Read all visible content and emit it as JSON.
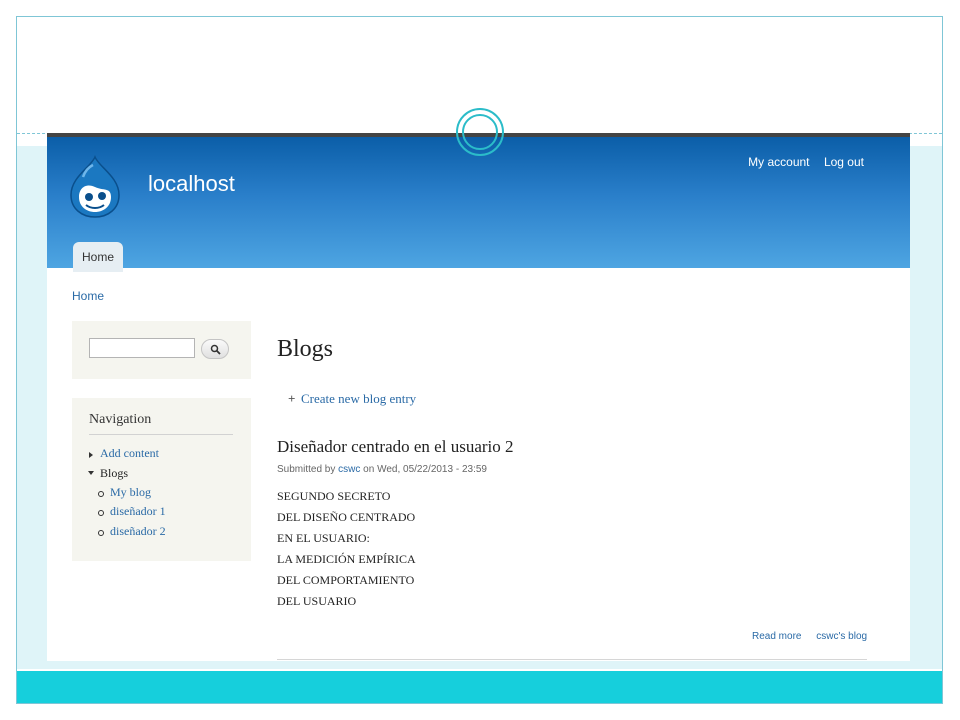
{
  "site": {
    "name": "localhost"
  },
  "secondary_menu": {
    "items": [
      "My account",
      "Log out"
    ]
  },
  "main_menu": {
    "tabs": [
      "Home"
    ]
  },
  "breadcrumb": "Home",
  "search": {
    "value": "",
    "button_icon": "search-icon"
  },
  "navigation": {
    "title": "Navigation",
    "items": [
      "Add content",
      "Blogs"
    ],
    "subitems": [
      "My blog",
      "diseñador 1",
      "diseñador 2"
    ]
  },
  "page": {
    "title": "Blogs",
    "create_link": "Create new blog entry"
  },
  "post": {
    "title": "Diseñador centrado en el usuario 2",
    "submitted_prefix": "Submitted by",
    "author": "cswc",
    "submitted_suffix": "on Wed, 05/22/2013 - 23:59",
    "body_lines": [
      "SEGUNDO SECRETO",
      "DEL DISEÑO CENTRADO",
      "EN EL USUARIO:",
      "LA MEDICIÓN EMPÍRICA",
      "DEL COMPORTAMIENTO",
      "DEL USUARIO"
    ],
    "links": [
      "Read more",
      "cswc's blog"
    ]
  },
  "colors": {
    "accent": "#16cfdc",
    "header_top": "#0b5ea8",
    "header_bottom": "#4ea5e2",
    "link": "#2a6aa6"
  }
}
